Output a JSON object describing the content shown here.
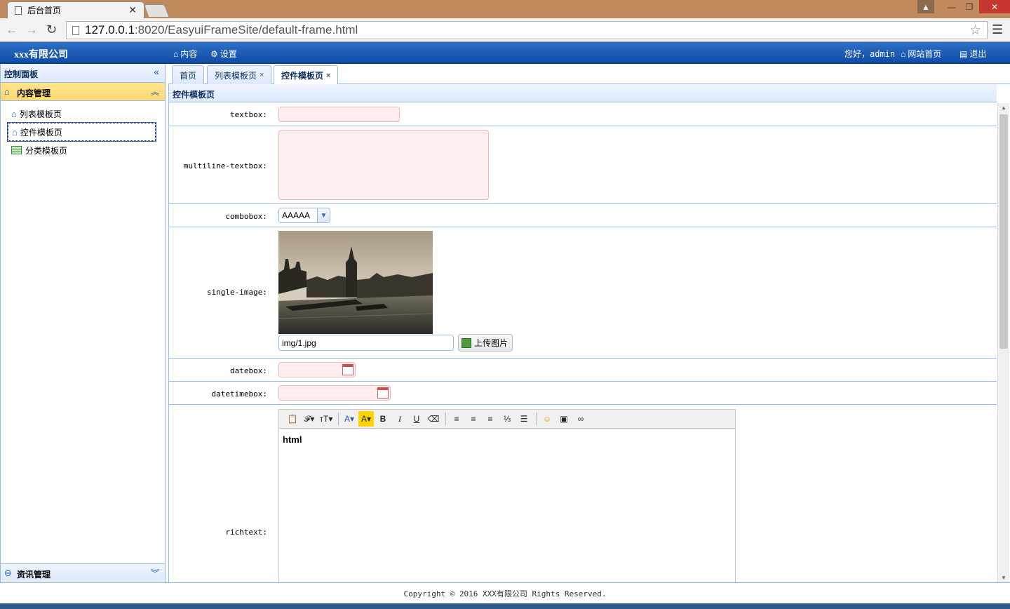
{
  "browser": {
    "tab_title": "后台首页",
    "url_host": "127.0.0.1",
    "url_rest": ":8020/EasyuiFrameSite/default-frame.html"
  },
  "header": {
    "brand": "xxx有限公司",
    "nav_content": "内容",
    "nav_settings": "设置",
    "greeting": "您好，admin",
    "nav_home": "网站首页",
    "nav_logout": "退出"
  },
  "sidebar": {
    "title": "控制面板",
    "content_group": "内容管理",
    "items": [
      {
        "label": "列表模板页"
      },
      {
        "label": "控件模板页"
      },
      {
        "label": "分类模板页"
      }
    ],
    "news_group": "资讯管理"
  },
  "tabs": [
    {
      "label": "首页"
    },
    {
      "label": "列表模板页"
    },
    {
      "label": "控件模板页"
    }
  ],
  "panel": {
    "title": "控件模板页"
  },
  "form": {
    "textbox_label": "textbox:",
    "multiline_label": "multiline-textbox:",
    "combobox_label": "combobox:",
    "combobox_value": "AAAAA",
    "single_image_label": "single-image:",
    "image_path": "img/1.jpg",
    "upload_label": "上传图片",
    "datebox_label": "datebox:",
    "datetimebox_label": "datetimebox:",
    "richtext_label": "richtext:",
    "richtext_content": "html"
  },
  "footer": {
    "text": "Copyright © 2016 XXX有限公司 Rights Reserved."
  },
  "colors": {
    "header_blue": "#1558b3",
    "panel_border": "#99bbe8",
    "accordion_active": "#ffd86e",
    "required_bg": "#ffeeee"
  }
}
